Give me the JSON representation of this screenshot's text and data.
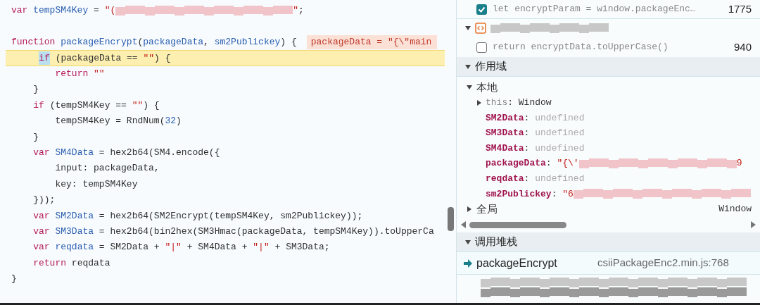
{
  "editor": {
    "lines": [
      {
        "current": false,
        "tokens": [
          {
            "kind": "kw",
            "t": "var"
          },
          {
            "kind": "def",
            "t": " tempSM4Key"
          },
          {
            "kind": "plain",
            "t": " ="
          },
          {
            "kind": "str",
            "t": " \"("
          },
          {
            "kind": "blur"
          },
          {
            "kind": "str",
            "t": "\""
          },
          {
            "kind": "plain",
            "t": ";"
          }
        ]
      },
      {
        "current": false
      },
      {
        "current": false,
        "inline_value": "packageData = \"{\\\"main",
        "tokens": [
          {
            "kind": "kw",
            "t": "function"
          },
          {
            "kind": "def",
            "t": " packageEncrypt"
          },
          {
            "kind": "plain",
            "t": "("
          },
          {
            "kind": "def",
            "t": "packageData"
          },
          {
            "kind": "plain",
            "t": ","
          },
          {
            "kind": "def",
            "t": " sm2Publickey"
          },
          {
            "kind": "plain",
            "t": ") {"
          }
        ]
      },
      {
        "current": true,
        "tokens": [
          {
            "kind": "kw",
            "t": "    if",
            "highlighted": true
          },
          {
            "kind": "plain",
            "t": " (packageData =="
          },
          {
            "kind": "str",
            "t": " \"\""
          },
          {
            "kind": "plain",
            "t": ") {"
          }
        ]
      },
      {
        "current": false,
        "tokens": [
          {
            "kind": "kw",
            "t": "        return"
          },
          {
            "kind": "str",
            "t": " \"\""
          }
        ]
      },
      {
        "current": false,
        "tokens": [
          {
            "kind": "plain",
            "t": "    }"
          }
        ]
      },
      {
        "current": false,
        "tokens": [
          {
            "kind": "kw",
            "t": "    if"
          },
          {
            "kind": "plain",
            "t": " (tempSM4Key =="
          },
          {
            "kind": "str",
            "t": " \"\""
          },
          {
            "kind": "plain",
            "t": ") {"
          }
        ]
      },
      {
        "current": false,
        "tokens": [
          {
            "kind": "plain",
            "t": "        tempSM4Key = RndNum("
          },
          {
            "kind": "num",
            "t": "32"
          },
          {
            "kind": "plain",
            "t": ")"
          }
        ]
      },
      {
        "current": false,
        "tokens": [
          {
            "kind": "plain",
            "t": "    }"
          }
        ]
      },
      {
        "current": false,
        "tokens": [
          {
            "kind": "kw",
            "t": "    var"
          },
          {
            "kind": "def",
            "t": " SM4Data"
          },
          {
            "kind": "plain",
            "t": " = hex2b64(SM4.encode({"
          }
        ]
      },
      {
        "current": false,
        "tokens": [
          {
            "kind": "plain",
            "t": "        input: packageData,"
          }
        ]
      },
      {
        "current": false,
        "tokens": [
          {
            "kind": "plain",
            "t": "        key: tempSM4Key"
          }
        ]
      },
      {
        "current": false,
        "tokens": [
          {
            "kind": "plain",
            "t": "    }));"
          }
        ]
      },
      {
        "current": false,
        "tokens": [
          {
            "kind": "kw",
            "t": "    var"
          },
          {
            "kind": "def",
            "t": " SM2Data"
          },
          {
            "kind": "plain",
            "t": " = hex2b64(SM2Encrypt(tempSM4Key, sm2Publickey));"
          }
        ]
      },
      {
        "current": false,
        "tokens": [
          {
            "kind": "kw",
            "t": "    var"
          },
          {
            "kind": "def",
            "t": " SM3Data"
          },
          {
            "kind": "plain",
            "t": " = hex2b64(bin2hex(SM3Hmac(packageData, tempSM4Key)).toUpperCa"
          }
        ]
      },
      {
        "current": false,
        "tokens": [
          {
            "kind": "kw",
            "t": "    var"
          },
          {
            "kind": "def",
            "t": " reqdata"
          },
          {
            "kind": "plain",
            "t": " = SM2Data +"
          },
          {
            "kind": "str",
            "t": " \"|\""
          },
          {
            "kind": "plain",
            "t": " + SM4Data +"
          },
          {
            "kind": "str",
            "t": " \"|\""
          },
          {
            "kind": "plain",
            "t": " + SM3Data;"
          }
        ]
      },
      {
        "current": false,
        "tokens": [
          {
            "kind": "kw",
            "t": "    return"
          },
          {
            "kind": "plain",
            "t": " reqdata"
          }
        ]
      },
      {
        "current": false,
        "tokens": [
          {
            "kind": "plain",
            "t": "}"
          }
        ]
      }
    ]
  },
  "breakpoints": [
    {
      "kind": "item",
      "checked": true,
      "code": "let encryptParam = window.packageEnc…",
      "line": "1775"
    },
    {
      "kind": "file",
      "expanded": true
    },
    {
      "kind": "item",
      "checked": false,
      "code": "return encryptData.toUpperCase()",
      "line": "940"
    }
  ],
  "scope": {
    "title": "作用域",
    "expanded": true,
    "groups": [
      {
        "title": "本地",
        "expanded": true,
        "items": [
          {
            "kind": "object",
            "name": "this",
            "value": ": Window",
            "expanded": false
          },
          {
            "kind": "undefined",
            "name": "SM2Data",
            "value": ": undefined"
          },
          {
            "kind": "undefined",
            "name": "SM3Data",
            "value": ": undefined"
          },
          {
            "kind": "undefined",
            "name": "SM4Data",
            "value": ": undefined"
          },
          {
            "kind": "string",
            "name": "packageData",
            "value": ": \"{\\'",
            "blurred": true,
            "value_end": "9"
          },
          {
            "kind": "undefined",
            "name": "reqdata",
            "value": ": undefined"
          },
          {
            "kind": "string",
            "name": "sm2Publickey",
            "value": ": \"6",
            "blurred": true
          }
        ]
      },
      {
        "title": "全局",
        "expanded": false,
        "value": "Window"
      }
    ]
  },
  "call_stack": {
    "title": "调用堆栈",
    "expanded": true,
    "frames": [
      {
        "kind": "frame",
        "name": "packageEncrypt",
        "location": "csiiPackageEnc2.min.js:768",
        "selected": true
      },
      {
        "kind": "redacted",
        "selected": false
      }
    ]
  }
}
